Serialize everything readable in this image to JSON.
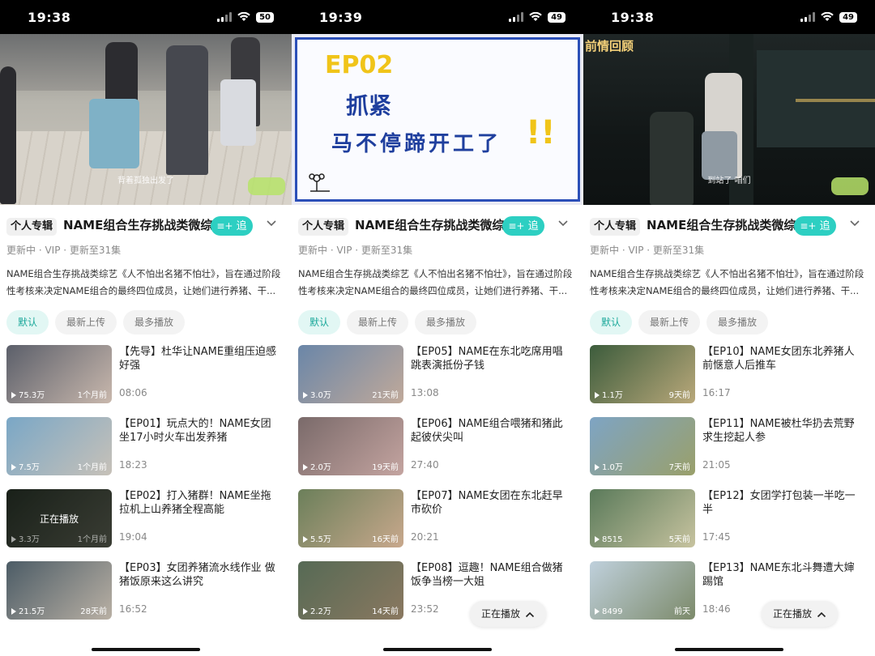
{
  "screens": [
    {
      "status": {
        "time": "19:38",
        "battery": "50"
      },
      "video": {
        "caption": "背着孤独出发了",
        "brand": ""
      },
      "header": {
        "tag": "个人专辑",
        "title": "NAME组合生存挑战类微综",
        "follow": "追"
      },
      "meta": "更新中 · VIP · 更新至31集",
      "desc": "NAME组合生存挑战类综艺《人不怕出名猪不怕壮》，旨在通过阶段性考核来决定NAME组合的最终四位成员，让她们进行养猪、干...",
      "sort": [
        "默认",
        "最新上传",
        "最多播放"
      ],
      "items": [
        {
          "title": "【先导】杜华让NAME重组压迫感好强",
          "views": "75.3万",
          "age": "1个月前",
          "duration": "08:06",
          "playing": ""
        },
        {
          "title": "【EP01】玩点大的！NAME女团坐17小时火车出发养猪",
          "views": "7.5万",
          "age": "1个月前",
          "duration": "18:23",
          "playing": ""
        },
        {
          "title": "【EP02】打入猪群！NAME坐拖拉机上山养猪全程高能",
          "views": "3.3万",
          "age": "1个月前",
          "duration": "19:04",
          "playing": "正在播放"
        },
        {
          "title": "【EP03】女团养猪流水线作业 做猪饭原来这么讲究",
          "views": "21.5万",
          "age": "28天前",
          "duration": "16:52",
          "playing": ""
        }
      ],
      "nowplaying": ""
    },
    {
      "status": {
        "time": "19:39",
        "battery": "49"
      },
      "video": {
        "ep": "EP02",
        "line1": "抓紧",
        "line2": "马不停蹄开工了",
        "bang": "!!"
      },
      "header": {
        "tag": "个人专辑",
        "title": "NAME组合生存挑战类微综",
        "follow": "追"
      },
      "meta": "更新中 · VIP · 更新至31集",
      "desc": "NAME组合生存挑战类综艺《人不怕出名猪不怕壮》，旨在通过阶段性考核来决定NAME组合的最终四位成员，让她们进行养猪、干...",
      "sort": [
        "默认",
        "最新上传",
        "最多播放"
      ],
      "items": [
        {
          "title": "【EP05】NAME在东北吃席用唱跳表演抵份子钱",
          "views": "3.0万",
          "age": "21天前",
          "duration": "13:08",
          "playing": ""
        },
        {
          "title": "【EP06】NAME组合喂猪和猪此起彼伏尖叫",
          "views": "2.0万",
          "age": "19天前",
          "duration": "27:40",
          "playing": ""
        },
        {
          "title": "【EP07】NAME女团在东北赶早市砍价",
          "views": "5.5万",
          "age": "16天前",
          "duration": "20:21",
          "playing": ""
        },
        {
          "title": "【EP08】逗趣！NAME组合做猪饭争当榜一大姐",
          "views": "2.2万",
          "age": "14天前",
          "duration": "23:52",
          "playing": ""
        }
      ],
      "nowplaying": "正在播放"
    },
    {
      "status": {
        "time": "19:38",
        "battery": "49"
      },
      "video": {
        "caption": "到站了 咱们",
        "brand": "前情回顾"
      },
      "header": {
        "tag": "个人专辑",
        "title": "NAME组合生存挑战类微综",
        "follow": "追"
      },
      "meta": "更新中 · VIP · 更新至31集",
      "desc": "NAME组合生存挑战类综艺《人不怕出名猪不怕壮》，旨在通过阶段性考核来决定NAME组合的最终四位成员，让她们进行养猪、干...",
      "sort": [
        "默认",
        "最新上传",
        "最多播放"
      ],
      "items": [
        {
          "title": "【EP10】NAME女团东北养猪人前惬意人后推车",
          "views": "1.1万",
          "age": "9天前",
          "duration": "16:17",
          "playing": ""
        },
        {
          "title": "【EP11】NAME被杜华扔去荒野求生挖起人参",
          "views": "1.0万",
          "age": "7天前",
          "duration": "21:05",
          "playing": ""
        },
        {
          "title": "【EP12】女团学打包装一半吃一半",
          "views": "8515",
          "age": "5天前",
          "duration": "17:45",
          "playing": ""
        },
        {
          "title": "【EP13】NAME东北斗舞遭大婶踢馆",
          "views": "8499",
          "age": "前天",
          "duration": "18:46",
          "playing": ""
        }
      ],
      "nowplaying": "正在播放"
    }
  ],
  "colors": {
    "accent": "#2dcfc2",
    "chip_active_bg": "#e2f7f4",
    "chip_active_text": "#1aa89a"
  }
}
